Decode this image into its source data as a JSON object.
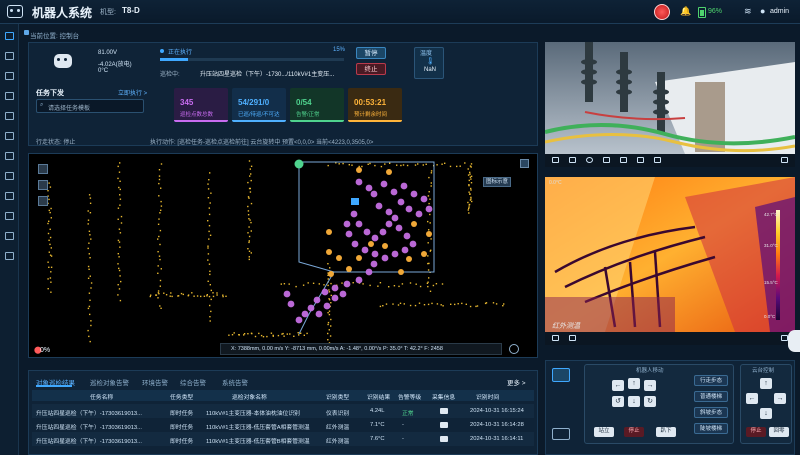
{
  "header": {
    "title": "机器人系统",
    "model_label": "机型:",
    "model_value": "T8-D",
    "battery": "96%",
    "user": "admin"
  },
  "breadcrumb": "当前位置: 控制台",
  "robot": {
    "voltage": "81.00V",
    "current": "-4.02A(放电)",
    "temperature": "0°C"
  },
  "task": {
    "issue_label": "任务下发",
    "issue_link": "立即执行 >",
    "select_placeholder": "请选择任务模板",
    "running_label": "正在执行",
    "progress_text": "15%",
    "progress_value": 0.15,
    "current_label": "巡检中:",
    "current_value": "升压站四星巡检（下午）-1730.../110kV#1主变压...",
    "pause_label": "暂停",
    "stop_label": "终止",
    "temp_label": "温度",
    "temp_value": "NaN"
  },
  "stats": [
    {
      "value": "345",
      "label": "巡检点数总数",
      "color": "#c86cf0",
      "bg": "#2a1c44"
    },
    {
      "value": "54/291/0",
      "label": "已巡/待巡/不可达",
      "color": "#4fb0ff",
      "bg": "#122e4a"
    },
    {
      "value": "0/54",
      "label": "告警/正常",
      "color": "#4fd38e",
      "bg": "#123628"
    },
    {
      "value": "00:53:21",
      "label": "预计剩余时间",
      "color": "#ffb43a",
      "bg": "#3a2a12"
    }
  ],
  "status_lines": {
    "line1": "行走状态:  停止",
    "line2": "执行动作:  [巡检任务-巡检点巡检前往] 云台旋转中  预置<0,0,0>  当前<4223,0,3505,0>"
  },
  "map": {
    "legend_label": "图标示意",
    "location_pct": "0%",
    "coord_text": "X: 7388mm,   0.00 m/s    Y: -8713 mm,  0.00m/s    A: -1.48°,  0.00°/s    P: 35.0°    T: 42.2°    F: 2458"
  },
  "table": {
    "tabs": [
      "对象巡检结果",
      "巡检对象告警",
      "环境告警",
      "综合告警",
      "系统告警"
    ],
    "more_label": "更多 >",
    "headers": [
      "任务名称",
      "任务类型",
      "巡检对象名称",
      "识别类型",
      "识别结果",
      "告警等级",
      "采集信息",
      "识别时间"
    ],
    "rows": [
      [
        "升压站四星巡检（下午）-17303619013...",
        "即时任务",
        "110kV#1主变压器-本体油枕油位识别",
        "仪表识别",
        "4.24L",
        "正常",
        "image-icon",
        "2024-10-31 16:15:24"
      ],
      [
        "升压站四星巡检（下午）-17303619013...",
        "即时任务",
        "110kV#1主变压器-低压套管A相套管测温",
        "红外测温",
        "7.1°C",
        "-",
        "image-icon",
        "2024-10-31 16:14:28"
      ],
      [
        "升压站四星巡检（下午）-17303619013...",
        "即时任务",
        "110kV#1主变压器-低压套管B相套管测温",
        "红外测温",
        "7.6°C",
        "-",
        "image-icon",
        "2024-10-31 16:14:11"
      ]
    ]
  },
  "camera": {
    "thermal_label": "0.0°C",
    "scale_labels": [
      "42.7°C",
      "31.0°C",
      "15.5°C",
      "0.0°C"
    ],
    "watermark": "红外测温"
  },
  "control": {
    "dir_title": "机器人移动",
    "arm_title": "云台控制",
    "side_buttons": [
      "行走步态",
      "普通楼梯",
      "斜坡步态",
      "陡坡楼梯"
    ],
    "stand_label": "站立",
    "stop_label": "停止",
    "lie_label": "趴下",
    "arm_stop": "停止",
    "arm_back": "回零"
  },
  "colors": {
    "accent": "#3fa8ff",
    "map_points": "#e8b830",
    "map_path": "#c46ee0",
    "map_waypoint": "#f0a838"
  }
}
